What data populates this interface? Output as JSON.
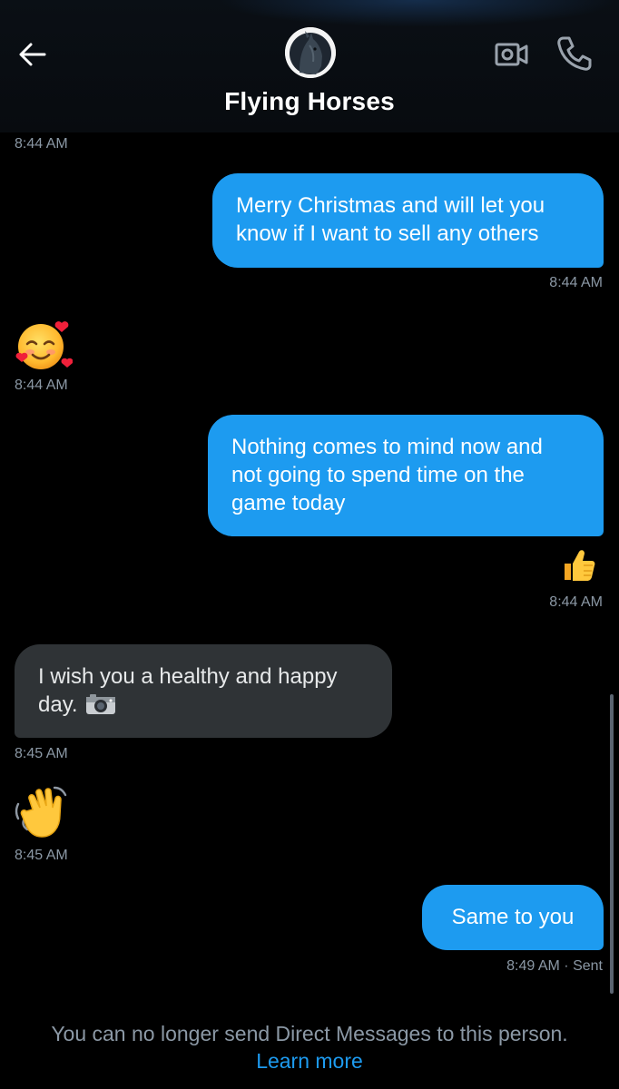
{
  "header": {
    "title": "Flying Horses",
    "back_icon": "arrow-left-icon",
    "video_icon": "video-camera-icon",
    "call_icon": "phone-icon"
  },
  "messages": [
    {
      "kind": "timestamp",
      "text": "8:44 AM"
    },
    {
      "kind": "outgoing",
      "lines": [
        "Merry Christmas and will let you",
        "know if I want to sell any others"
      ],
      "time": "8:44 AM"
    },
    {
      "kind": "incoming-emoji",
      "emoji": "smiling-face-with-hearts",
      "time": "8:44 AM"
    },
    {
      "kind": "outgoing",
      "lines": [
        "Nothing comes to mind now and",
        "not going to spend time on the",
        "game today"
      ]
    },
    {
      "kind": "outgoing-emoji",
      "emoji": "thumbs-up",
      "time": "8:44 AM"
    },
    {
      "kind": "incoming",
      "lines": [
        "I wish you a healthy and happy",
        "day."
      ],
      "emoji_suffix": "camera",
      "time": "8:45 AM"
    },
    {
      "kind": "incoming-emoji",
      "emoji": "waving-hand",
      "time": "8:45 AM"
    },
    {
      "kind": "outgoing",
      "lines": [
        "Same to you"
      ],
      "time": "8:49 AM",
      "status": "Sent"
    }
  ],
  "footer": {
    "note": "You can no longer send Direct Messages to this person.",
    "link": "Learn more"
  },
  "colors": {
    "accent": "#1d9bf0",
    "incoming_bubble": "#2f3336",
    "timestamp": "#8b98a5",
    "background": "#000000"
  }
}
